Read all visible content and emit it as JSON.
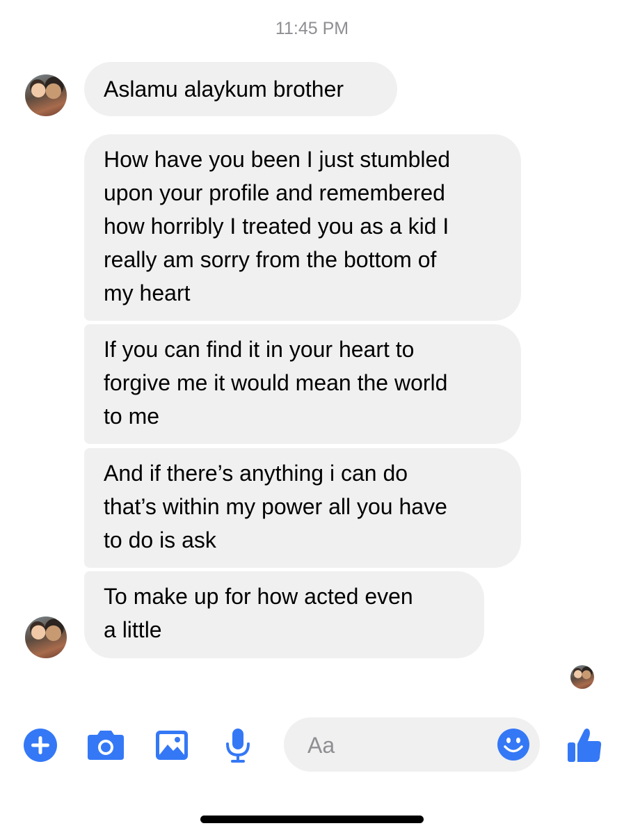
{
  "conversation": {
    "timestamp": "11:45 PM",
    "messages": [
      {
        "text": "Aslamu alaykum brother"
      },
      {
        "text": "How have you been I just stumbled\nupon your profile and remembered\nhow horribly I treated you as a kid I\nreally am sorry from the bottom of\nmy heart"
      },
      {
        "text": "If you can find it in your heart to\nforgive me it would mean the world\nto me"
      },
      {
        "text": "And if there’s anything i can do\nthat’s within my power all you have\nto do is ask"
      },
      {
        "text": "To make up for how acted even\na little"
      }
    ]
  },
  "composer": {
    "placeholder": "Aa",
    "icons": [
      "plus-icon",
      "camera-icon",
      "gallery-icon",
      "microphone-icon",
      "emoji-icon",
      "thumbs-up-icon"
    ],
    "accent_color": "#3478f6"
  }
}
